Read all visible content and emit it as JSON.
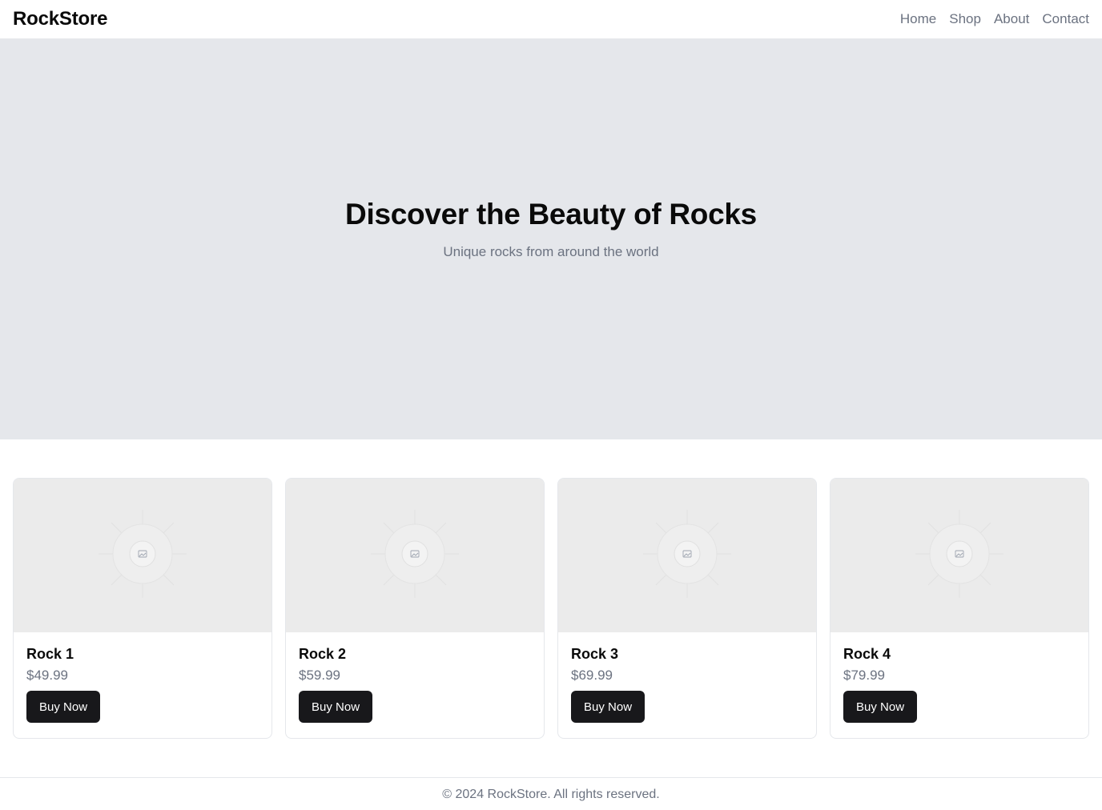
{
  "header": {
    "brand": "RockStore",
    "nav": [
      {
        "label": "Home"
      },
      {
        "label": "Shop"
      },
      {
        "label": "About"
      },
      {
        "label": "Contact"
      }
    ]
  },
  "hero": {
    "title": "Discover the Beauty of Rocks",
    "subtitle": "Unique rocks from around the world"
  },
  "products": [
    {
      "name": "Rock 1",
      "price": "$49.99",
      "button_label": "Buy Now",
      "image_icon": "image-placeholder-icon"
    },
    {
      "name": "Rock 2",
      "price": "$59.99",
      "button_label": "Buy Now",
      "image_icon": "image-placeholder-icon"
    },
    {
      "name": "Rock 3",
      "price": "$69.99",
      "button_label": "Buy Now",
      "image_icon": "image-placeholder-icon"
    },
    {
      "name": "Rock 4",
      "price": "$79.99",
      "button_label": "Buy Now",
      "image_icon": "image-placeholder-icon"
    }
  ],
  "footer": {
    "text": "© 2024 RockStore. All rights reserved."
  },
  "colors": {
    "hero_background": "#e5e7eb",
    "button_background": "#18181b",
    "muted_text": "#6b7280"
  }
}
